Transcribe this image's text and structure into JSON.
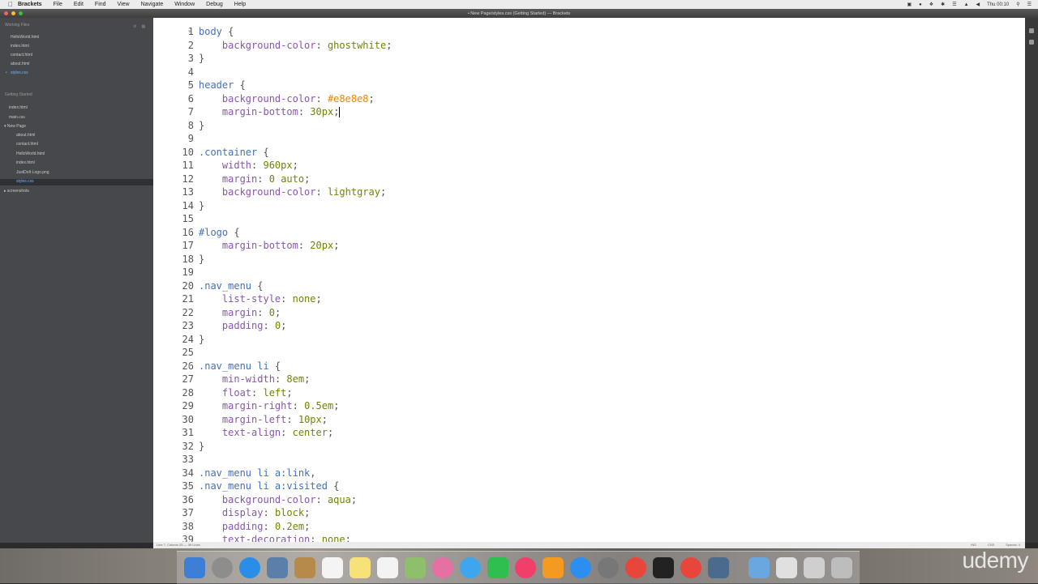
{
  "menubar": {
    "app": "Brackets",
    "items": [
      "File",
      "Edit",
      "Find",
      "View",
      "Navigate",
      "Window",
      "Debug",
      "Help"
    ],
    "clock": "Thu 00:10"
  },
  "window": {
    "title": "• New Page/styles.css (Getting Started) — Brackets"
  },
  "sidebar": {
    "working_files_header": "Working Files",
    "working_files": [
      "HelloWorld.html",
      "index.html",
      "contact.html",
      "about.html",
      "styles.css"
    ],
    "project_header": "Getting Started",
    "project_items": [
      "index.html",
      "main.css",
      "New Page",
      "about.html",
      "contact.html",
      "HelloWorld.html",
      "index.html",
      "JustDoIt Logo.png",
      "styles.css",
      "screenshots"
    ]
  },
  "editor": {
    "lines": [
      "body {",
      "    background-color: ghostwhite;",
      "}",
      "",
      "header {",
      "    background-color: #e8e8e8;",
      "    margin-bottom: 30px;",
      "}",
      "",
      ".container {",
      "    width: 960px;",
      "    margin: 0 auto;",
      "    background-color: lightgray;",
      "}",
      "",
      "#logo {",
      "    margin-bottom: 20px;",
      "}",
      "",
      ".nav_menu {",
      "    list-style: none;",
      "    margin: 0;",
      "    padding: 0;",
      "}",
      "",
      ".nav_menu li {",
      "    min-width: 8em;",
      "    float: left;",
      "    margin-right: 0.5em;",
      "    margin-left: 10px;",
      "    text-align: center;",
      "}",
      "",
      ".nav_menu li a:link,",
      ".nav_menu li a:visited {",
      "    background-color: aqua;",
      "    display: block;",
      "    padding: 0.2em;",
      "    text-decoration: none;"
    ],
    "fold_lines": [
      1,
      5,
      10,
      16,
      20,
      26,
      35
    ]
  },
  "statusbar": {
    "position": "Line 7, Column 25 — 39 Lines",
    "ins": "INS",
    "mode": "CSS",
    "spaces": "Spaces: 4"
  },
  "watermark": "udemy",
  "colors": {
    "selector": "#446fbd",
    "property": "#8757ad",
    "value": "#6d8600",
    "hex": "#e88501",
    "sidebar_bg": "#47484b",
    "sidebar_selected": "#6fb3ff"
  }
}
